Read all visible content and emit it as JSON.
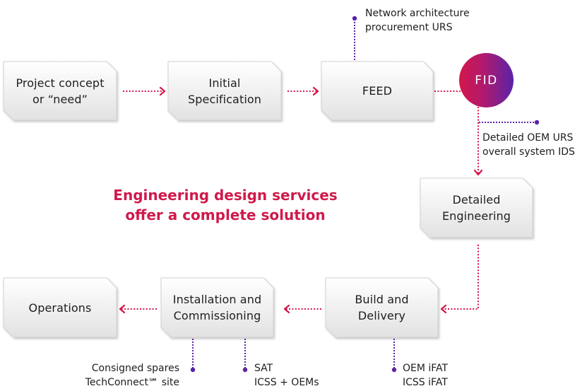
{
  "colors": {
    "flow_line": "#d4174a",
    "note_line": "#5b23a8",
    "headline": "#cf1a4b",
    "box_fill_top": "#ffffff",
    "box_fill_bottom": "#e4e4e4",
    "box_border": "#cfcfcf",
    "fid_gradient_start": "#d4174a",
    "fid_gradient_end": "#5a23a8"
  },
  "headline": "Engineering design services\noffer a complete solution",
  "stages": {
    "project_concept": "Project concept\nor “need”",
    "initial_specification": "Initial\nSpecification",
    "feed": "FEED",
    "fid": "FID",
    "detailed_engineering": "Detailed\nEngineering",
    "build_and_delivery": "Build and\nDelivery",
    "installation_commissioning": "Installation and\nCommissioning",
    "operations": "Operations"
  },
  "notes": {
    "feed": "Network architecture\nprocurement URS",
    "fid": "Detailed OEM URS\noverall system IDS",
    "installation_spares": "Consigned spares\nTechConnect℠ site",
    "installation_sat": "SAT\nICSS + OEMs",
    "build": "OEM iFAT\nICSS iFAT"
  }
}
